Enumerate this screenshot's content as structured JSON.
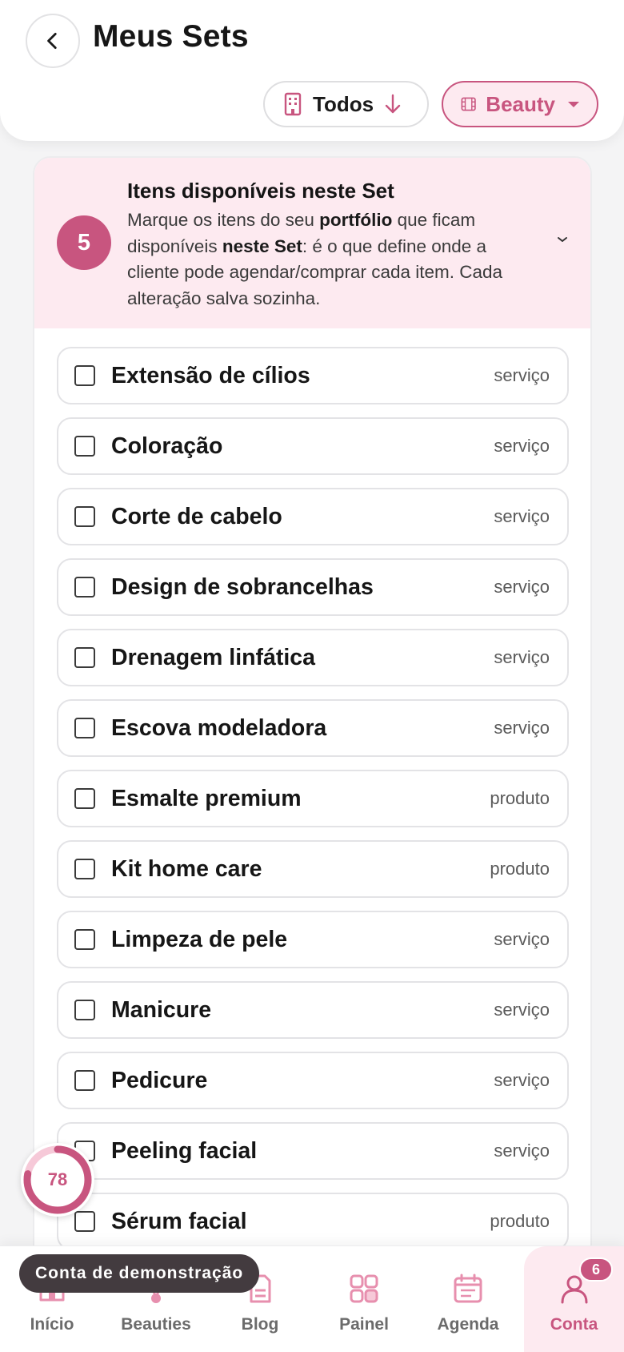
{
  "header": {
    "title": "Meus Sets",
    "filter_all": "Todos",
    "filter_brand": "Beauty"
  },
  "info": {
    "step": "5",
    "title": "Itens disponíveis neste Set",
    "text_1": "Marque os itens do seu ",
    "text_bold_1": "portfólio",
    "text_2": " que ficam disponíveis ",
    "text_bold_2": "neste Set",
    "text_3": ": é o que define onde a cliente pode agendar/comprar cada item. Cada alteração salva sozinha."
  },
  "items": [
    {
      "name": "Extensão de cílios",
      "type": "serviço"
    },
    {
      "name": "Coloração",
      "type": "serviço"
    },
    {
      "name": "Corte de cabelo",
      "type": "serviço"
    },
    {
      "name": "Design de sobrancelhas",
      "type": "serviço"
    },
    {
      "name": "Drenagem linfática",
      "type": "serviço"
    },
    {
      "name": "Escova modeladora",
      "type": "serviço"
    },
    {
      "name": "Esmalte premium",
      "type": "produto"
    },
    {
      "name": "Kit home care",
      "type": "produto"
    },
    {
      "name": "Limpeza de pele",
      "type": "serviço"
    },
    {
      "name": "Manicure",
      "type": "serviço"
    },
    {
      "name": "Pedicure",
      "type": "serviço"
    },
    {
      "name": "Peeling facial",
      "type": "serviço"
    },
    {
      "name": "Sérum facial",
      "type": "produto"
    }
  ],
  "score": {
    "value": "78",
    "progress": 0.78
  },
  "toast": "Conta de demonstração",
  "nav": {
    "inicio": "Início",
    "beauties": "Beauties",
    "blog": "Blog",
    "painel": "Painel",
    "agenda": "Agenda",
    "conta": "Conta",
    "conta_badge": "6"
  },
  "colors": {
    "accent": "#c8557f",
    "accent_light": "#fdeaf0",
    "text": "#161616"
  }
}
